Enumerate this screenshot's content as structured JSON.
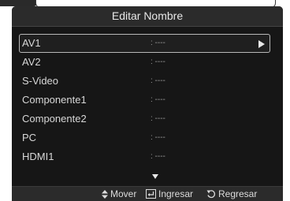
{
  "header": {
    "title": "Editar Nombre"
  },
  "list": {
    "items": [
      {
        "name": "AV1",
        "value": ": ----"
      },
      {
        "name": "AV2",
        "value": ": ----"
      },
      {
        "name": "S-Video",
        "value": ": ----"
      },
      {
        "name": "Componente1",
        "value": ": ----"
      },
      {
        "name": "Componente2",
        "value": ": ----"
      },
      {
        "name": "PC",
        "value": ": ----"
      },
      {
        "name": "HDMI1",
        "value": ": ----"
      }
    ],
    "selected_index": 0
  },
  "footer": {
    "move_label": "Mover",
    "enter_label": "Ingresar",
    "return_label": "Regresar"
  },
  "icons": [
    "up-down-arrows-icon",
    "enter-icon",
    "return-icon",
    "right-arrow-icon",
    "down-arrow-icon"
  ]
}
